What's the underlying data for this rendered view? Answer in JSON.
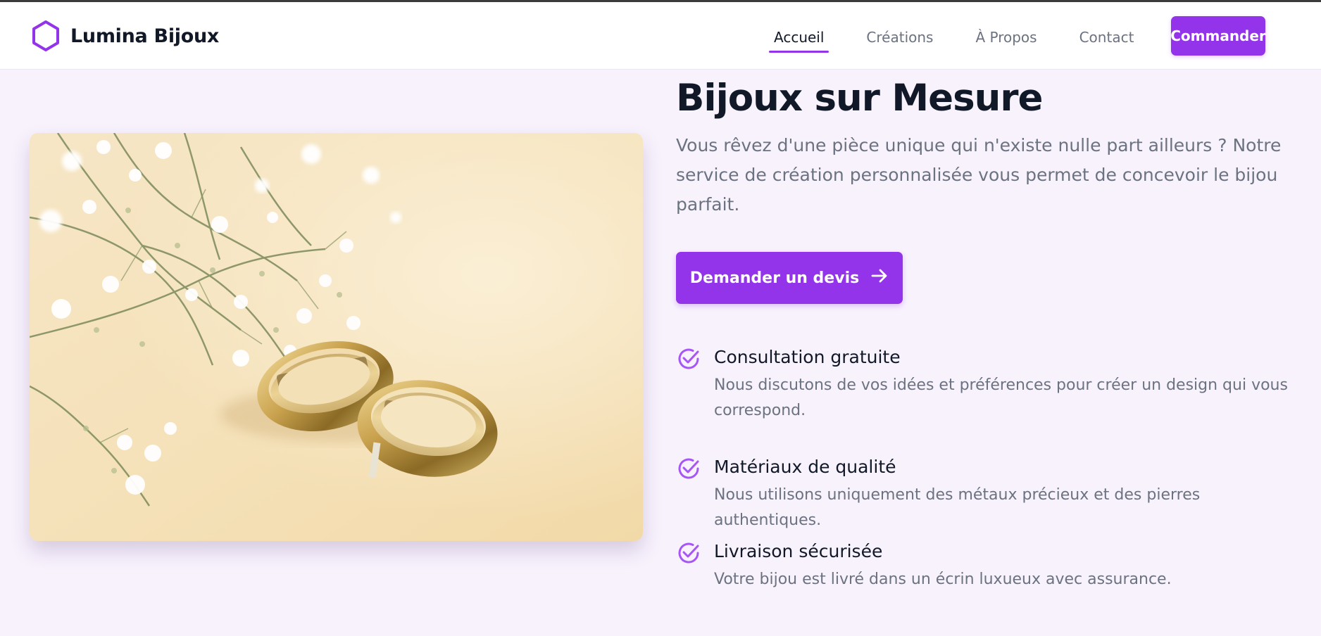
{
  "header": {
    "brand": {
      "name": "Lumina Bijoux",
      "logo_icon": "hexagon-icon"
    },
    "nav": [
      {
        "label": "Accueil",
        "active": true
      },
      {
        "label": "Créations",
        "active": false
      },
      {
        "label": "À Propos",
        "active": false
      },
      {
        "label": "Contact",
        "active": false
      }
    ],
    "order_button": "Commander"
  },
  "hero": {
    "image_alt": "Deux alliances en or avec fleurs de gypsophile",
    "title": "Bijoux sur Mesure",
    "lead": "Vous rêvez d'une pièce unique qui n'existe nulle part ailleurs ? Notre service de création personnalisée vous permet de concevoir le bijou parfait.",
    "cta": {
      "label": "Demander un devis",
      "icon": "arrow-right-icon"
    }
  },
  "features": [
    {
      "icon": "check-circle-icon",
      "title": "Consultation gratuite",
      "description": "Nous discutons de vos idées et préférences pour créer un design qui vous correspond."
    },
    {
      "icon": "check-circle-icon",
      "title": "Matériaux de qualité",
      "description": "Nous utilisons uniquement des métaux précieux et des pierres authentiques."
    },
    {
      "icon": "check-circle-icon",
      "title": "Livraison sécurisée",
      "description": "Votre bijou est livré dans un écrin luxueux avec assurance."
    }
  ],
  "colors": {
    "accent": "#9333ea",
    "background": "#f8f2fd",
    "text": "#111827",
    "muted": "#6b7280"
  }
}
